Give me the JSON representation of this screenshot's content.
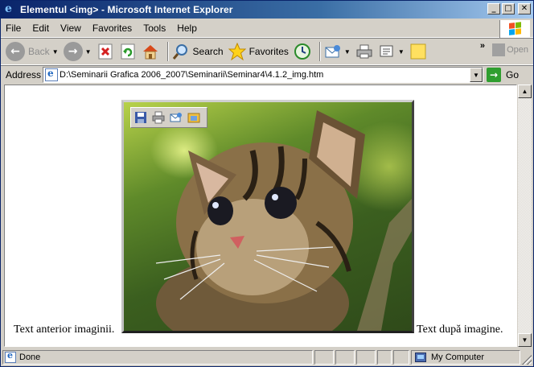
{
  "window": {
    "title": "Elementul <img> - Microsoft Internet Explorer",
    "controls": {
      "minimize": "_",
      "maximize": "□",
      "close": "✕"
    }
  },
  "menu": {
    "items": [
      {
        "label": "File"
      },
      {
        "label": "Edit"
      },
      {
        "label": "View"
      },
      {
        "label": "Favorites"
      },
      {
        "label": "Tools"
      },
      {
        "label": "Help"
      }
    ]
  },
  "toolbar": {
    "back_label": "Back",
    "search_label": "Search",
    "favorites_label": "Favorites",
    "overflow_label": "»",
    "open_label": "Open"
  },
  "address": {
    "label": "Address",
    "value": "D:\\Seminarii Grafica 2006_2007\\Seminarii\\Seminar4\\4.1.2_img.htm",
    "go_label": "Go"
  },
  "page": {
    "text_before": "Text anterior imaginii.",
    "text_after": "Text după imagine."
  },
  "status": {
    "text": "Done",
    "zone": "My Computer"
  },
  "colors": {
    "titlebar_start": "#0a246a",
    "titlebar_end": "#a6caf0",
    "chrome": "#d4d0c8",
    "go_green": "#2f9e2f"
  }
}
